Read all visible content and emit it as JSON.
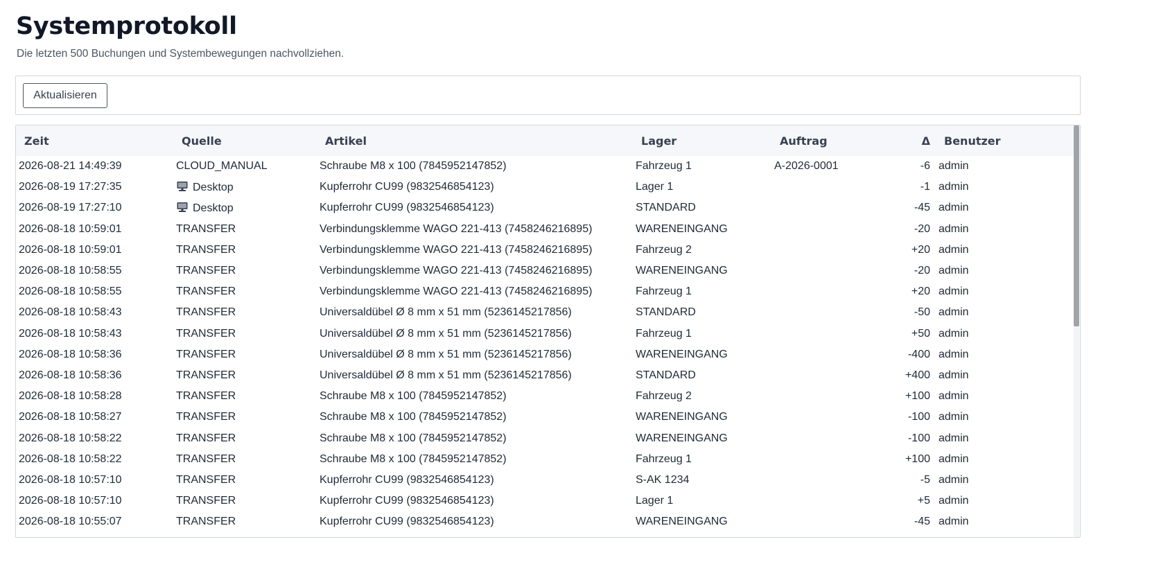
{
  "page": {
    "title": "Systemprotokoll",
    "subtitle": "Die letzten 500 Buchungen und Systembewegungen nachvollziehen."
  },
  "toolbar": {
    "refresh_label": "Aktualisieren"
  },
  "table": {
    "headers": {
      "time": "Zeit",
      "source": "Quelle",
      "article": "Artikel",
      "warehouse": "Lager",
      "order": "Auftrag",
      "delta": "Δ",
      "user": "Benutzer"
    },
    "rows": [
      {
        "time": "2026-08-21 14:49:39",
        "source": "CLOUD_MANUAL",
        "source_icon": "",
        "article": "Schraube M8 x 100 (7845952147852)",
        "warehouse": "Fahrzeug 1",
        "order": "A-2026-0001",
        "delta": "-6",
        "user": "admin"
      },
      {
        "time": "2026-08-19 17:27:35",
        "source": "Desktop",
        "source_icon": "desktop-computer-icon",
        "article": "Kupferrohr CU99 (9832546854123)",
        "warehouse": "Lager 1",
        "order": "",
        "delta": "-1",
        "user": "admin"
      },
      {
        "time": "2026-08-19 17:27:10",
        "source": "Desktop",
        "source_icon": "desktop-computer-icon",
        "article": "Kupferrohr CU99 (9832546854123)",
        "warehouse": "STANDARD",
        "order": "",
        "delta": "-45",
        "user": "admin"
      },
      {
        "time": "2026-08-18 10:59:01",
        "source": "TRANSFER",
        "source_icon": "",
        "article": "Verbindungsklemme WAGO 221-413 (7458246216895)",
        "warehouse": "WARENEINGANG",
        "order": "",
        "delta": "-20",
        "user": "admin"
      },
      {
        "time": "2026-08-18 10:59:01",
        "source": "TRANSFER",
        "source_icon": "",
        "article": "Verbindungsklemme WAGO 221-413 (7458246216895)",
        "warehouse": "Fahrzeug 2",
        "order": "",
        "delta": "+20",
        "user": "admin"
      },
      {
        "time": "2026-08-18 10:58:55",
        "source": "TRANSFER",
        "source_icon": "",
        "article": "Verbindungsklemme WAGO 221-413 (7458246216895)",
        "warehouse": "WARENEINGANG",
        "order": "",
        "delta": "-20",
        "user": "admin"
      },
      {
        "time": "2026-08-18 10:58:55",
        "source": "TRANSFER",
        "source_icon": "",
        "article": "Verbindungsklemme WAGO 221-413 (7458246216895)",
        "warehouse": "Fahrzeug 1",
        "order": "",
        "delta": "+20",
        "user": "admin"
      },
      {
        "time": "2026-08-18 10:58:43",
        "source": "TRANSFER",
        "source_icon": "",
        "article": "Universaldübel Ø 8 mm x 51 mm (5236145217856)",
        "warehouse": "STANDARD",
        "order": "",
        "delta": "-50",
        "user": "admin"
      },
      {
        "time": "2026-08-18 10:58:43",
        "source": "TRANSFER",
        "source_icon": "",
        "article": "Universaldübel Ø 8 mm x 51 mm (5236145217856)",
        "warehouse": "Fahrzeug 1",
        "order": "",
        "delta": "+50",
        "user": "admin"
      },
      {
        "time": "2026-08-18 10:58:36",
        "source": "TRANSFER",
        "source_icon": "",
        "article": "Universaldübel Ø 8 mm x 51 mm (5236145217856)",
        "warehouse": "WARENEINGANG",
        "order": "",
        "delta": "-400",
        "user": "admin"
      },
      {
        "time": "2026-08-18 10:58:36",
        "source": "TRANSFER",
        "source_icon": "",
        "article": "Universaldübel Ø 8 mm x 51 mm (5236145217856)",
        "warehouse": "STANDARD",
        "order": "",
        "delta": "+400",
        "user": "admin"
      },
      {
        "time": "2026-08-18 10:58:28",
        "source": "TRANSFER",
        "source_icon": "",
        "article": "Schraube M8 x 100 (7845952147852)",
        "warehouse": "Fahrzeug 2",
        "order": "",
        "delta": "+100",
        "user": "admin"
      },
      {
        "time": "2026-08-18 10:58:27",
        "source": "TRANSFER",
        "source_icon": "",
        "article": "Schraube M8 x 100 (7845952147852)",
        "warehouse": "WARENEINGANG",
        "order": "",
        "delta": "-100",
        "user": "admin"
      },
      {
        "time": "2026-08-18 10:58:22",
        "source": "TRANSFER",
        "source_icon": "",
        "article": "Schraube M8 x 100 (7845952147852)",
        "warehouse": "WARENEINGANG",
        "order": "",
        "delta": "-100",
        "user": "admin"
      },
      {
        "time": "2026-08-18 10:58:22",
        "source": "TRANSFER",
        "source_icon": "",
        "article": "Schraube M8 x 100 (7845952147852)",
        "warehouse": "Fahrzeug 1",
        "order": "",
        "delta": "+100",
        "user": "admin"
      },
      {
        "time": "2026-08-18 10:57:10",
        "source": "TRANSFER",
        "source_icon": "",
        "article": "Kupferrohr CU99 (9832546854123)",
        "warehouse": "S-AK 1234",
        "order": "",
        "delta": "-5",
        "user": "admin"
      },
      {
        "time": "2026-08-18 10:57:10",
        "source": "TRANSFER",
        "source_icon": "",
        "article": "Kupferrohr CU99 (9832546854123)",
        "warehouse": "Lager 1",
        "order": "",
        "delta": "+5",
        "user": "admin"
      },
      {
        "time": "2026-08-18 10:55:07",
        "source": "TRANSFER",
        "source_icon": "",
        "article": "Kupferrohr CU99 (9832546854123)",
        "warehouse": "WARENEINGANG",
        "order": "",
        "delta": "-45",
        "user": "admin"
      }
    ]
  },
  "scrollbar": {
    "position_fraction": 0.0
  }
}
